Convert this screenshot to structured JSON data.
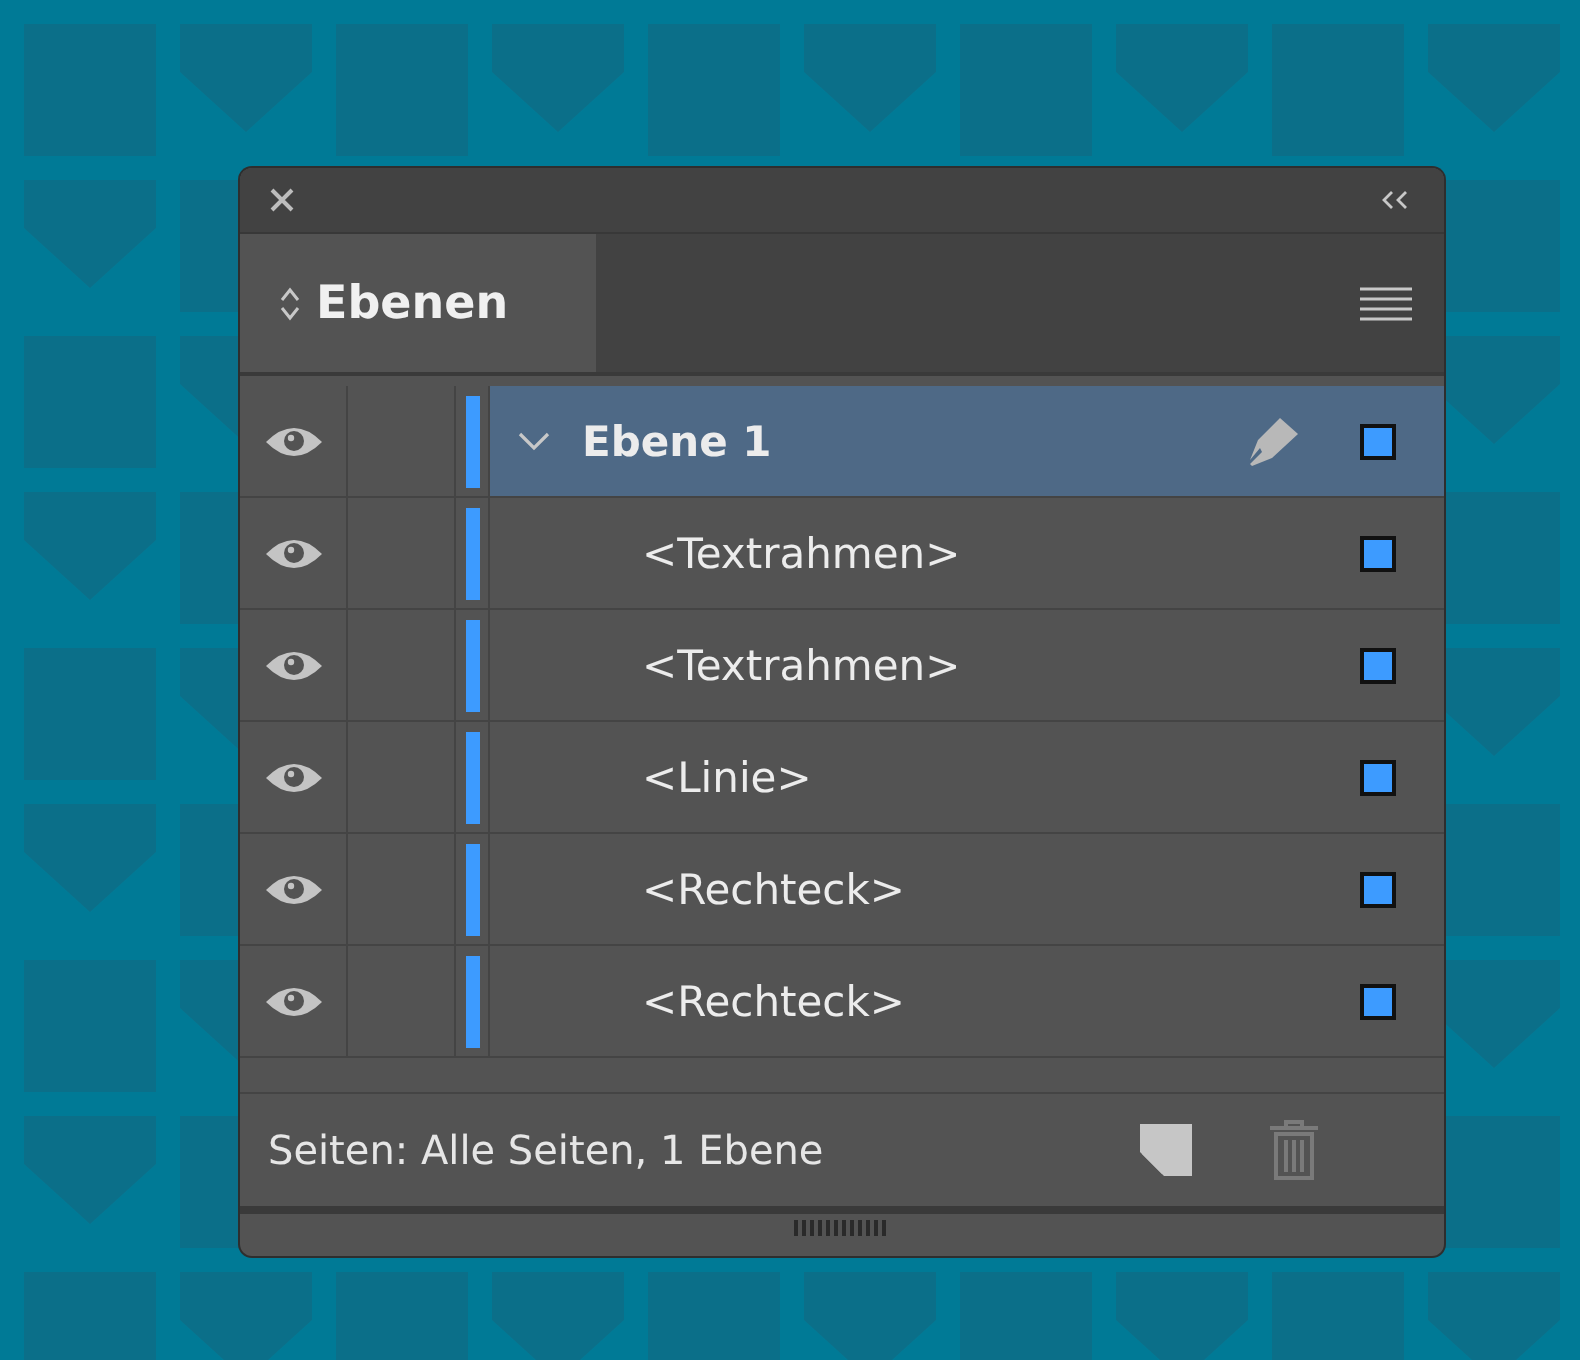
{
  "panel": {
    "tab": {
      "label": "Ebenen",
      "selected": true
    },
    "layers": [
      {
        "name": "Ebene 1",
        "visible": true,
        "selected": true,
        "expanded": true,
        "color": "#3d9bff",
        "children": [
          {
            "name": "<Textrahmen>",
            "visible": true,
            "selected": false,
            "color": "#3d9bff"
          },
          {
            "name": "<Textrahmen>",
            "visible": true,
            "selected": false,
            "color": "#3d9bff"
          },
          {
            "name": "<Linie>",
            "visible": true,
            "selected": false,
            "color": "#3d9bff"
          },
          {
            "name": "<Rechteck>",
            "visible": true,
            "selected": false,
            "color": "#3d9bff"
          },
          {
            "name": "<Rechteck>",
            "visible": true,
            "selected": false,
            "color": "#3d9bff"
          }
        ]
      }
    ],
    "status": "Seiten: Alle Seiten, 1 Ebene",
    "delete_disabled": true
  }
}
